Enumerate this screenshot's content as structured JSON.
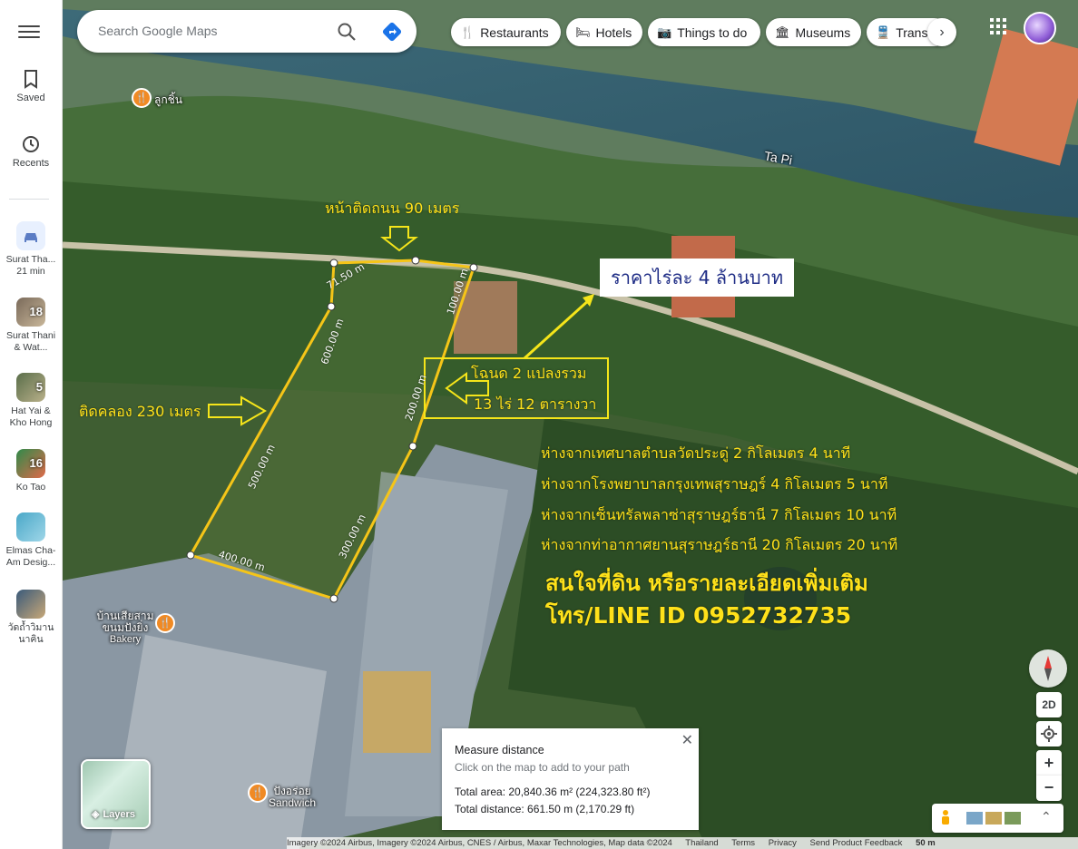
{
  "rail": {
    "saved": "Saved",
    "recents": "Recents",
    "items": [
      {
        "label": "Surat Tha...",
        "sub": "21 min"
      },
      {
        "label": "Surat Thani",
        "sub": "& Wat...",
        "count": "18"
      },
      {
        "label": "Hat Yai &",
        "sub": "Kho Hong",
        "count": "5"
      },
      {
        "label": "Ko Tao",
        "sub": "",
        "count": "16"
      },
      {
        "label": "Elmas Cha-",
        "sub": "Am Desig..."
      },
      {
        "label": "วัดถ้ำวิมาน",
        "sub": "นาคิน"
      }
    ]
  },
  "search": {
    "placeholder": "Search Google Maps"
  },
  "chips": [
    "Restaurants",
    "Hotels",
    "Things to do",
    "Museums",
    "Transit"
  ],
  "map": {
    "river_label": "Ta Pi",
    "place_top": "ลูกชิ้น",
    "place_bakery_1": "บ้านเสียสาม",
    "place_bakery_2": "ขนมปังยิ่ง",
    "place_bakery_3": "Bakery",
    "place_sandwich_1": "ปังอร่อย",
    "place_sandwich_2": "Sandwich",
    "segments": [
      "71.50 m",
      "100.00 m",
      "600.00 m",
      "200.00 m",
      "500.00 m",
      "300.00 m",
      "400.00 m"
    ]
  },
  "overlay": {
    "road_front": "หน้าติดถนน 90 เมตร",
    "canal_side": "ติดคลอง 230 เมตร",
    "price": "ราคาไร่ละ 4 ล้านบาท",
    "deed_1": "โฉนด 2 แปลงรวม",
    "deed_2": "13 ไร่ 12 ตารางวา",
    "dist_1": "ห่างจากเทศบาลตำบลวัดประดู่ 2 กิโลเมตร 4 นาที",
    "dist_2": "ห่างจากโรงพยาบาลกรุงเทพสุราษฎร์ 4 กิโลเมตร 5 นาที",
    "dist_3": "ห่างจากเซ็นทรัลพลาซ่าสุราษฎร์ธานี 7 กิโลเมตร 10 นาที",
    "dist_4": "ห่างจากท่าอากาศยานสุราษฎร์ธานี 20 กิโลเมตร 20 นาที",
    "contact_1": "สนใจที่ดิน หรือรายละเอียดเพิ่มเติม",
    "contact_2": "โทร/LINE ID 0952732735"
  },
  "measure": {
    "title": "Measure distance",
    "hint": "Click on the map to add to your path",
    "area": "Total area: 20,840.36 m² (224,323.80 ft²)",
    "distance": "Total distance: 661.50 m (2,170.29 ft)"
  },
  "layers_label": "Layers",
  "controls": {
    "mode": "2D",
    "zoom_in": "+",
    "zoom_out": "−"
  },
  "footer": {
    "imagery": "Imagery ©2024 Airbus, Imagery ©2024 Airbus, CNES / Airbus, Maxar Technologies, Map data ©2024",
    "country": "Thailand",
    "terms": "Terms",
    "privacy": "Privacy",
    "feedback": "Send Product Feedback",
    "scale": "50 m"
  }
}
